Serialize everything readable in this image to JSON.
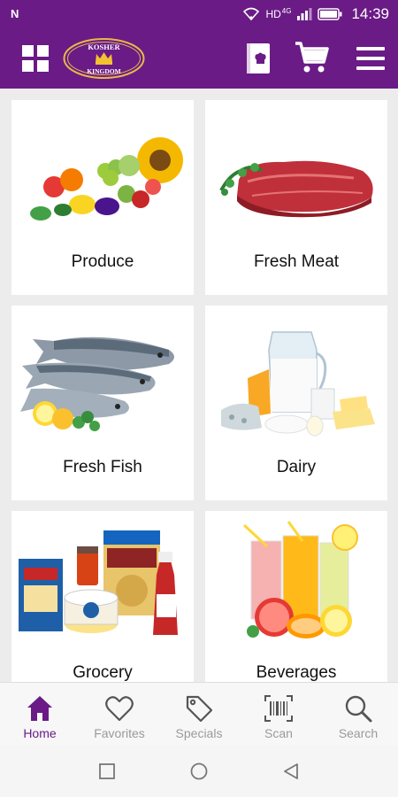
{
  "status_bar": {
    "notification_icon": "n-notification-icon",
    "network": "HD",
    "network_gen": "4G",
    "time": "14:39"
  },
  "app_bar": {
    "logo_text_top": "KOSHER",
    "logo_text_bottom": "KINGDOM",
    "brand_color": "#6a1b86"
  },
  "categories": [
    {
      "label": "Produce",
      "image": "produce-image"
    },
    {
      "label": "Fresh Meat",
      "image": "fresh-meat-image"
    },
    {
      "label": "Fresh Fish",
      "image": "fresh-fish-image"
    },
    {
      "label": "Dairy",
      "image": "dairy-image"
    },
    {
      "label": "Grocery",
      "image": "grocery-image"
    },
    {
      "label": "Beverages",
      "image": "beverages-image"
    }
  ],
  "bottom_nav": {
    "items": [
      {
        "label": "Home",
        "icon": "home-icon",
        "active": true
      },
      {
        "label": "Favorites",
        "icon": "heart-icon",
        "active": false
      },
      {
        "label": "Specials",
        "icon": "tag-icon",
        "active": false
      },
      {
        "label": "Scan",
        "icon": "barcode-scan-icon",
        "active": false
      },
      {
        "label": "Search",
        "icon": "search-icon",
        "active": false
      }
    ],
    "active_color": "#6a1b86",
    "inactive_color": "#9a9a9a"
  }
}
